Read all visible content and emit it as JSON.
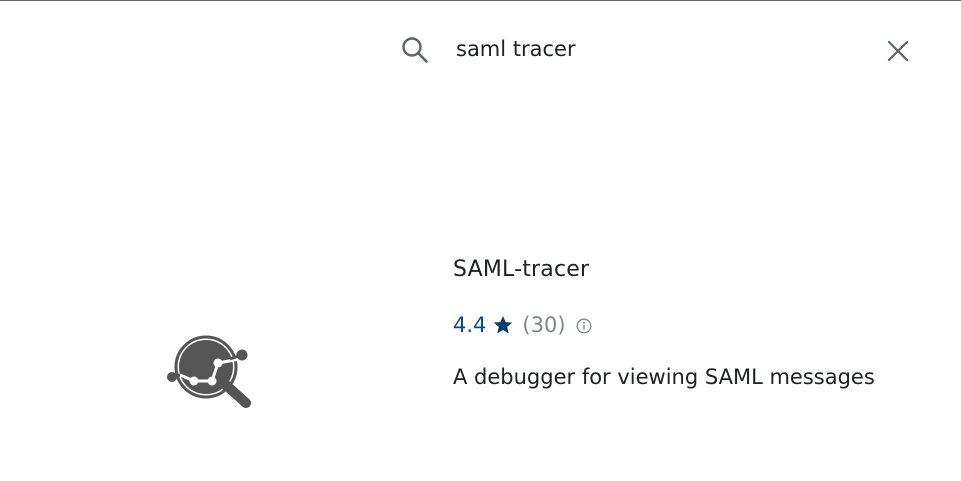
{
  "search": {
    "query": "saml tracer"
  },
  "result": {
    "title": "SAML-tracer",
    "rating": "4.4",
    "rating_count": "(30)",
    "description": "A debugger for viewing SAML messages"
  },
  "icons": {
    "search": "search-icon",
    "clear": "close-icon",
    "star": "star-icon",
    "info": "info-icon",
    "logo": "magnifier-graph-logo"
  },
  "colors": {
    "rating": "#0b4a85",
    "star": "#0b3c66",
    "muted": "#80868b",
    "text": "#202124",
    "logo": "#555555"
  }
}
